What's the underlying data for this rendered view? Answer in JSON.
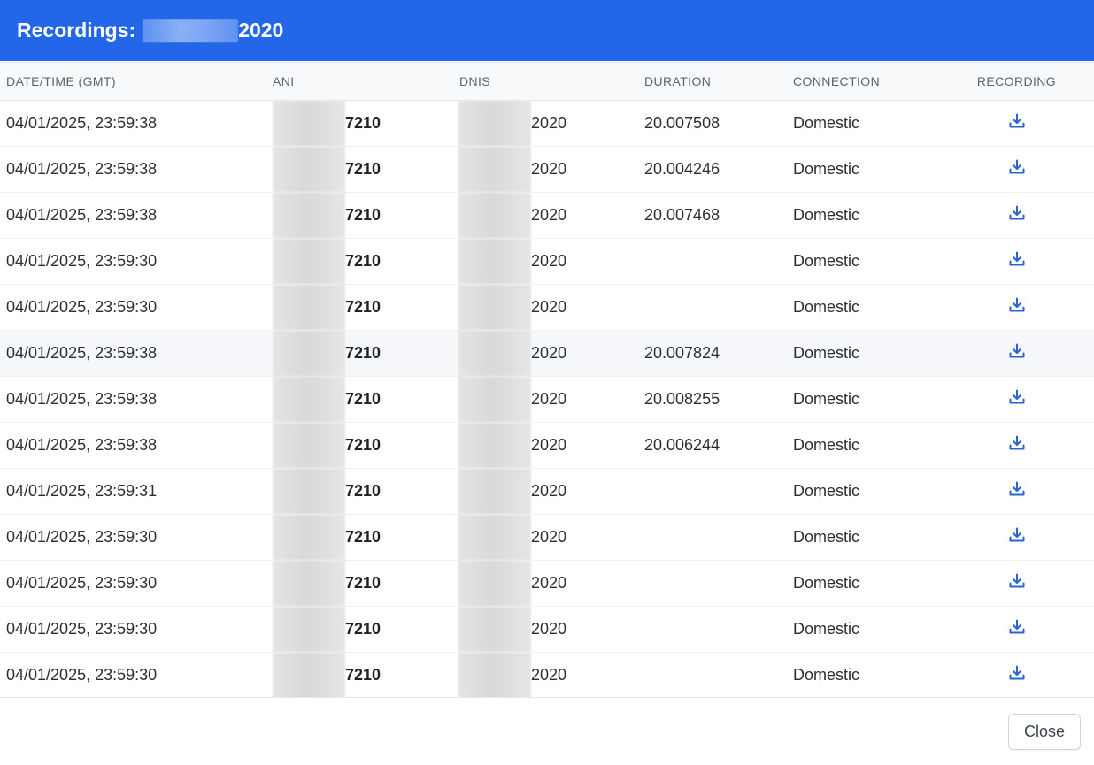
{
  "header": {
    "title_prefix": "Recordings:",
    "title_suffix": "2020"
  },
  "table": {
    "columns": [
      "DATE/TIME (GMT)",
      "ANI",
      "DNIS",
      "DURATION",
      "CONNECTION",
      "RECORDING"
    ],
    "rows": [
      {
        "datetime": "04/01/2025, 23:59:38",
        "ani": "7210",
        "dnis": "2020",
        "duration": "20.007508",
        "connection": "Domestic"
      },
      {
        "datetime": "04/01/2025, 23:59:38",
        "ani": "7210",
        "dnis": "2020",
        "duration": "20.004246",
        "connection": "Domestic"
      },
      {
        "datetime": "04/01/2025, 23:59:38",
        "ani": "7210",
        "dnis": "2020",
        "duration": "20.007468",
        "connection": "Domestic"
      },
      {
        "datetime": "04/01/2025, 23:59:30",
        "ani": "7210",
        "dnis": "2020",
        "duration": "",
        "connection": "Domestic"
      },
      {
        "datetime": "04/01/2025, 23:59:30",
        "ani": "7210",
        "dnis": "2020",
        "duration": "",
        "connection": "Domestic"
      },
      {
        "datetime": "04/01/2025, 23:59:38",
        "ani": "7210",
        "dnis": "2020",
        "duration": "20.007824",
        "connection": "Domestic"
      },
      {
        "datetime": "04/01/2025, 23:59:38",
        "ani": "7210",
        "dnis": "2020",
        "duration": "20.008255",
        "connection": "Domestic"
      },
      {
        "datetime": "04/01/2025, 23:59:38",
        "ani": "7210",
        "dnis": "2020",
        "duration": "20.006244",
        "connection": "Domestic"
      },
      {
        "datetime": "04/01/2025, 23:59:31",
        "ani": "7210",
        "dnis": "2020",
        "duration": "",
        "connection": "Domestic"
      },
      {
        "datetime": "04/01/2025, 23:59:30",
        "ani": "7210",
        "dnis": "2020",
        "duration": "",
        "connection": "Domestic"
      },
      {
        "datetime": "04/01/2025, 23:59:30",
        "ani": "7210",
        "dnis": "2020",
        "duration": "",
        "connection": "Domestic"
      },
      {
        "datetime": "04/01/2025, 23:59:30",
        "ani": "7210",
        "dnis": "2020",
        "duration": "",
        "connection": "Domestic"
      },
      {
        "datetime": "04/01/2025, 23:59:30",
        "ani": "7210",
        "dnis": "2020",
        "duration": "",
        "connection": "Domestic"
      }
    ],
    "recording_icon": "download-icon"
  },
  "footer": {
    "close_label": "Close"
  },
  "colors": {
    "header_bg": "#2366e8",
    "icon": "#2a63d6"
  }
}
